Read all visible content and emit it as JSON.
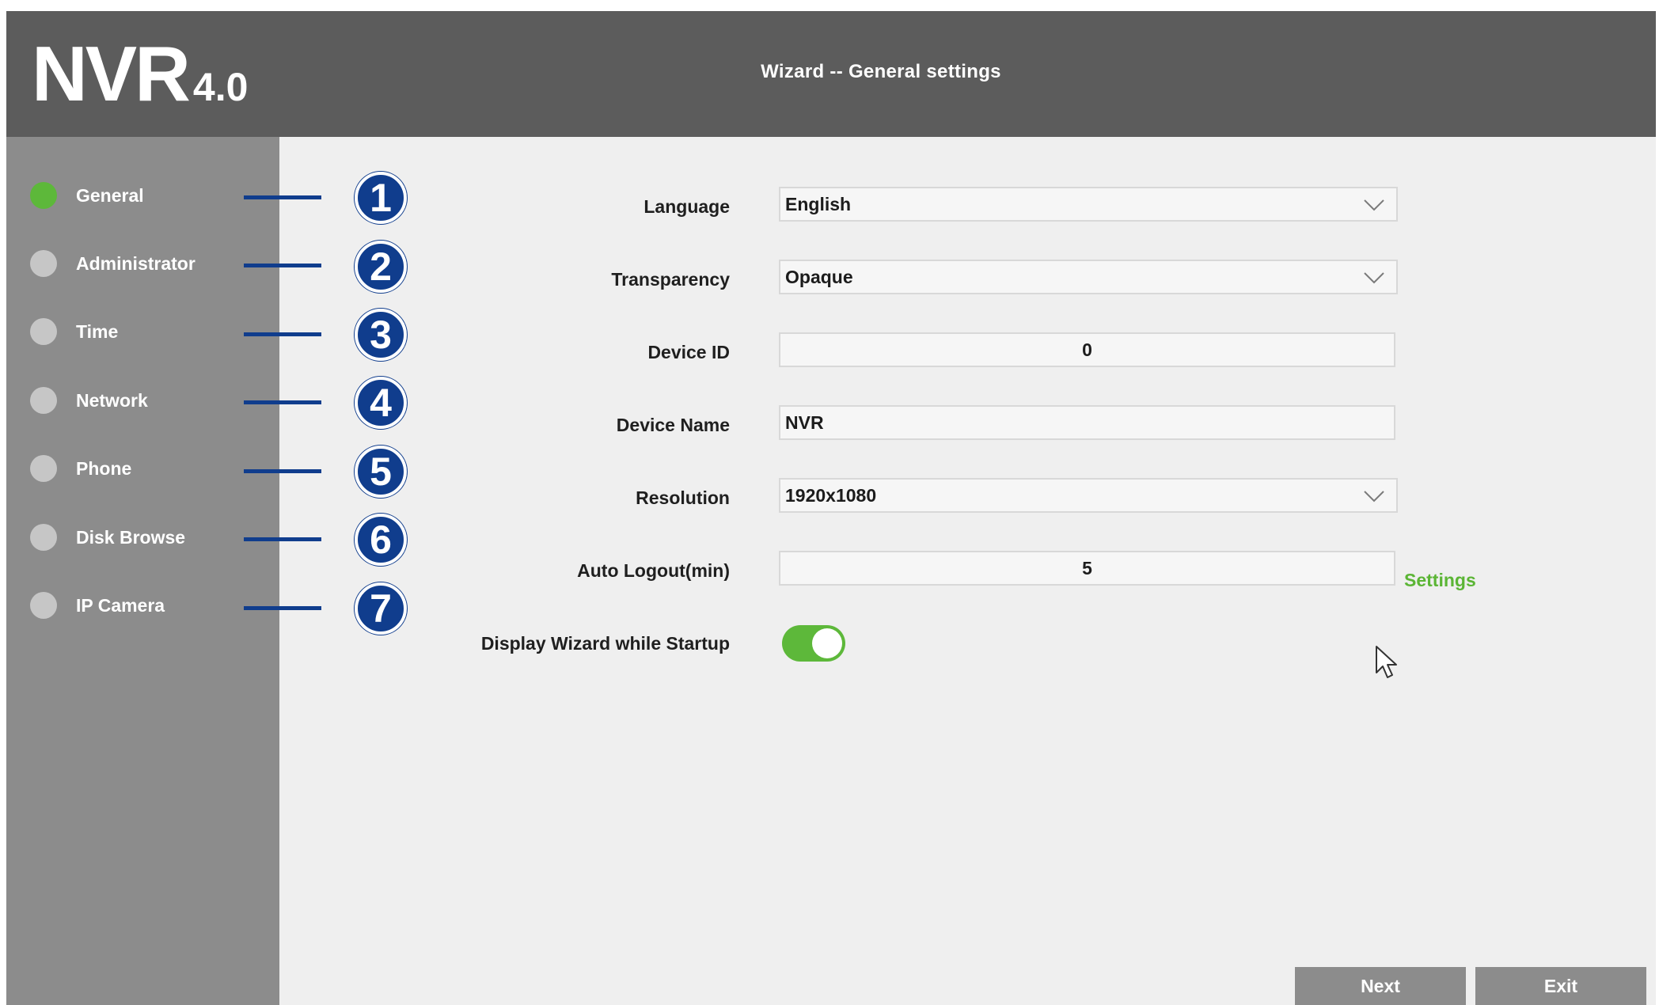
{
  "header": {
    "brand": "NVR",
    "version": "4.0",
    "title": "Wizard -- General settings"
  },
  "sidebar": {
    "items": [
      {
        "label": "General",
        "active": true
      },
      {
        "label": "Administrator",
        "active": false
      },
      {
        "label": "Time",
        "active": false
      },
      {
        "label": "Network",
        "active": false
      },
      {
        "label": "Phone",
        "active": false
      },
      {
        "label": "Disk Browse",
        "active": false
      },
      {
        "label": "IP Camera",
        "active": false
      }
    ]
  },
  "annotations": [
    "1",
    "2",
    "3",
    "4",
    "5",
    "6",
    "7"
  ],
  "form": {
    "language": {
      "label": "Language",
      "value": "English"
    },
    "transparency": {
      "label": "Transparency",
      "value": "Opaque"
    },
    "device_id": {
      "label": "Device ID",
      "value": "0"
    },
    "device_name": {
      "label": "Device Name",
      "value": "NVR"
    },
    "resolution": {
      "label": "Resolution",
      "value": "1920x1080"
    },
    "auto_logout": {
      "label": "Auto Logout(min)",
      "value": "5",
      "link": "Settings"
    },
    "display_wizard": {
      "label": "Display Wizard while Startup",
      "enabled": true
    }
  },
  "buttons": {
    "next": "Next",
    "exit": "Exit"
  },
  "colors": {
    "header_bg": "#5c5c5c",
    "sidebar_bg": "#8c8c8c",
    "content_bg": "#efefef",
    "accent_green": "#5db83a",
    "annotation_blue": "#103d8d"
  },
  "icons": {
    "dropdown": "chevron-down-icon",
    "cursor": "mouse-pointer-icon"
  }
}
